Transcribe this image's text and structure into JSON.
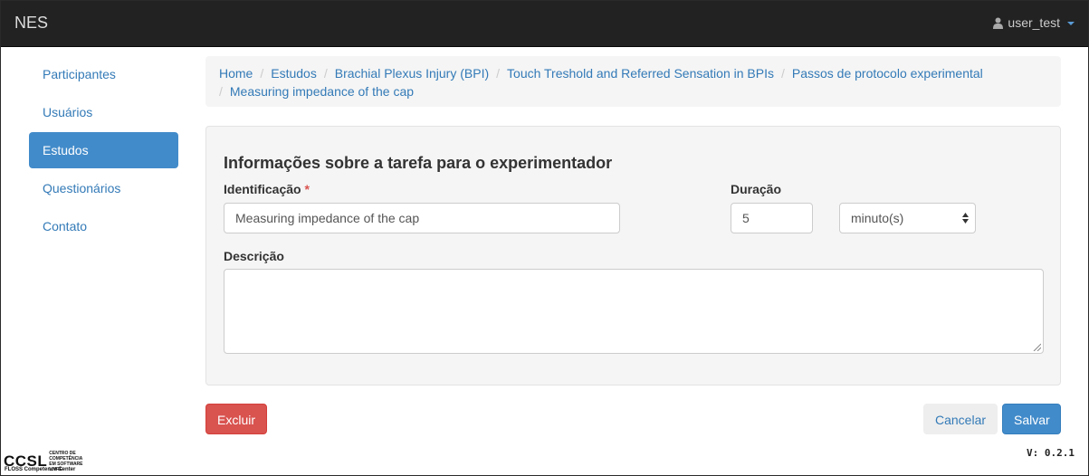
{
  "navbar": {
    "brand": "NES",
    "user": "user_test",
    "icons": [
      "user-icon",
      "caret-down-icon"
    ]
  },
  "sidebar": {
    "items": [
      {
        "label": "Participantes",
        "active": false
      },
      {
        "label": "Usuários",
        "active": false
      },
      {
        "label": "Estudos",
        "active": true
      },
      {
        "label": "Questionários",
        "active": false
      },
      {
        "label": "Contato",
        "active": false
      }
    ]
  },
  "breadcrumb": [
    "Home",
    "Estudos",
    "Brachial Plexus Injury (BPI)",
    "Touch Treshold and Referred Sensation in BPIs",
    "Passos de protocolo experimental",
    "Measuring impedance of the cap"
  ],
  "breadcrumb_separator": "/",
  "form": {
    "title": "Informações sobre a tarefa para o experimentador",
    "identificacao_label": "Identificação",
    "required_mark": "*",
    "identificacao_value": "Measuring impedance of the cap",
    "duracao_label": "Duração",
    "duracao_value": "5",
    "duracao_unit_selected": "minuto(s)",
    "descricao_label": "Descrição",
    "descricao_value": ""
  },
  "actions": {
    "delete_label": "Excluir",
    "cancel_label": "Cancelar",
    "save_label": "Salvar"
  },
  "footer": {
    "logo_text": "CCSL",
    "logo_small": "CENTRO DE COMPETÊNCIA EM SOFTWARE LIVRE",
    "logo_tagline": "FLOSS Competence Center",
    "version": "V: 0.2.1"
  },
  "colors": {
    "navbar_bg": "#222222",
    "link": "#337ab7",
    "active_nav": "#428bca",
    "danger": "#d9534f",
    "primary": "#428bca",
    "panel_bg": "#f5f5f5"
  }
}
